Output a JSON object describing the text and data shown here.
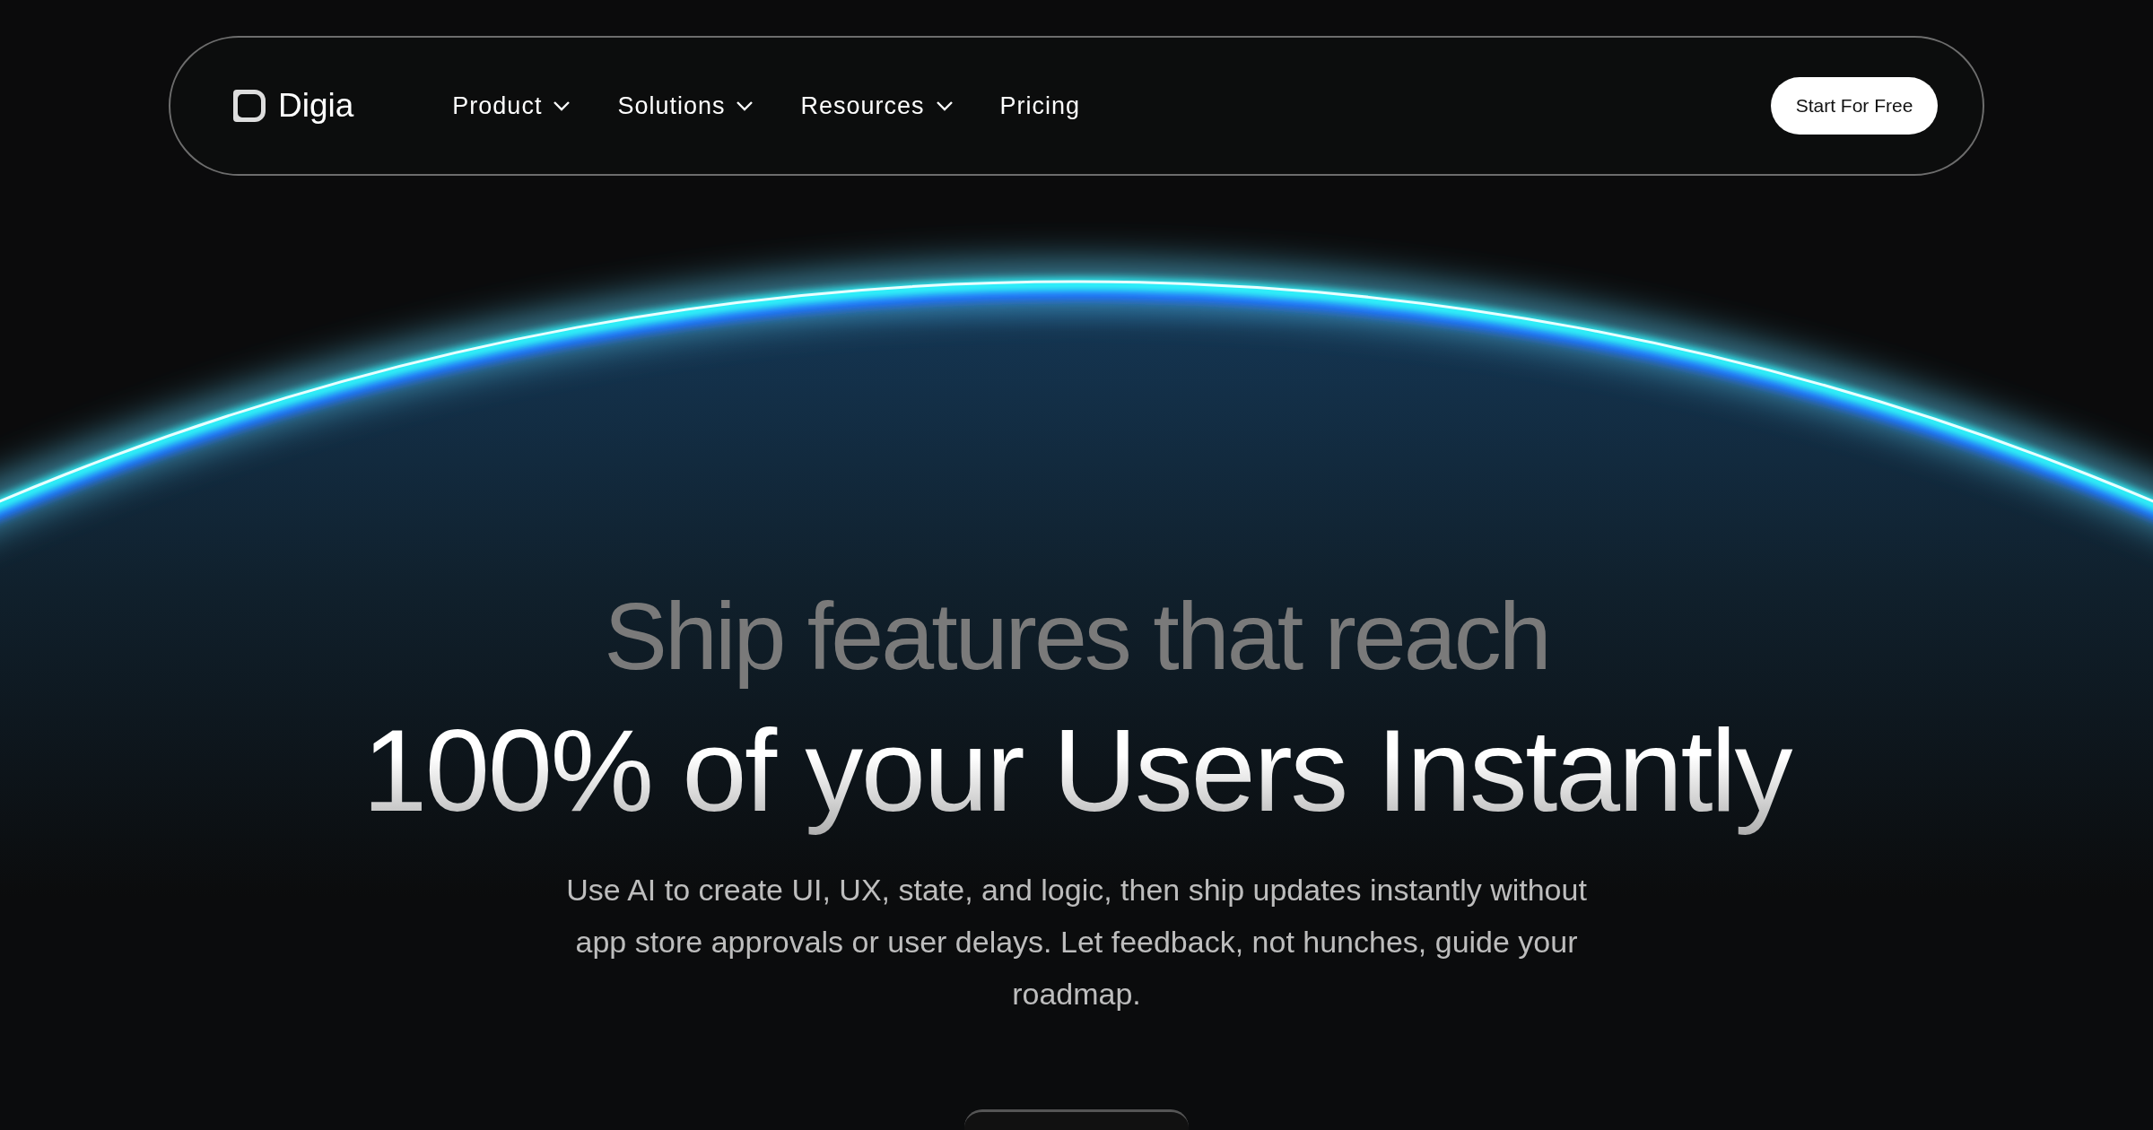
{
  "navbar": {
    "brand": "Digia",
    "links": [
      {
        "label": "Product",
        "kind": "dropdown"
      },
      {
        "label": "Solutions",
        "kind": "dropdown"
      },
      {
        "label": "Resources",
        "kind": "dropdown"
      },
      {
        "label": "Pricing",
        "kind": "link"
      }
    ],
    "cta": "Start For Free"
  },
  "hero": {
    "headline": "Ship features that reach",
    "headline_emphasis": "100% of your Users Instantly",
    "description": "Use AI to create UI, UX, state, and logic, then ship updates instantly without app store approvals or user delays. Let feedback, not hunches, guide your roadmap."
  }
}
